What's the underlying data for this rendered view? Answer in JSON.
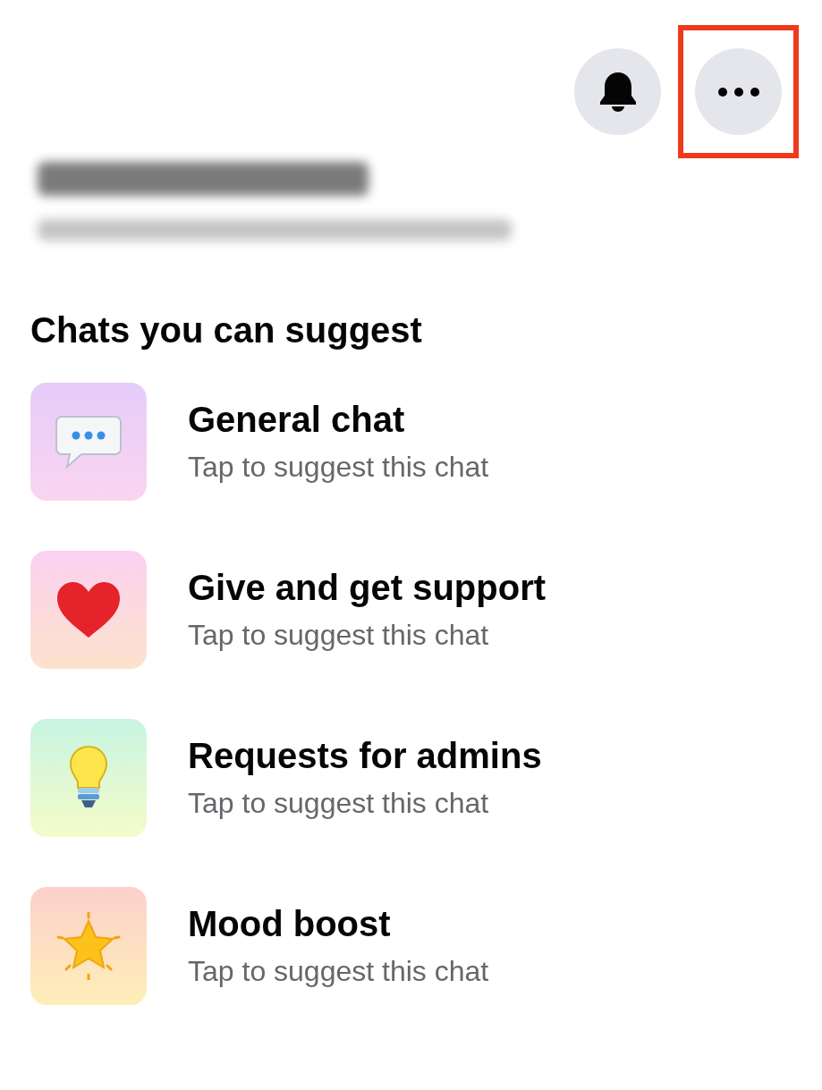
{
  "header": {
    "buttons": [
      {
        "kind": "bell",
        "highlighted": false
      },
      {
        "kind": "more",
        "highlighted": true
      }
    ]
  },
  "group": {
    "blurred": true
  },
  "section": {
    "title": "Chats you can suggest"
  },
  "chats": [
    {
      "kind": "speech",
      "title": "General chat",
      "subtitle": "Tap to suggest this chat"
    },
    {
      "kind": "heart",
      "title": "Give and get support",
      "subtitle": "Tap to suggest this chat"
    },
    {
      "kind": "bulb",
      "title": "Requests for admins",
      "subtitle": "Tap to suggest this chat"
    },
    {
      "kind": "star",
      "title": "Mood boost",
      "subtitle": "Tap to suggest this chat"
    }
  ]
}
